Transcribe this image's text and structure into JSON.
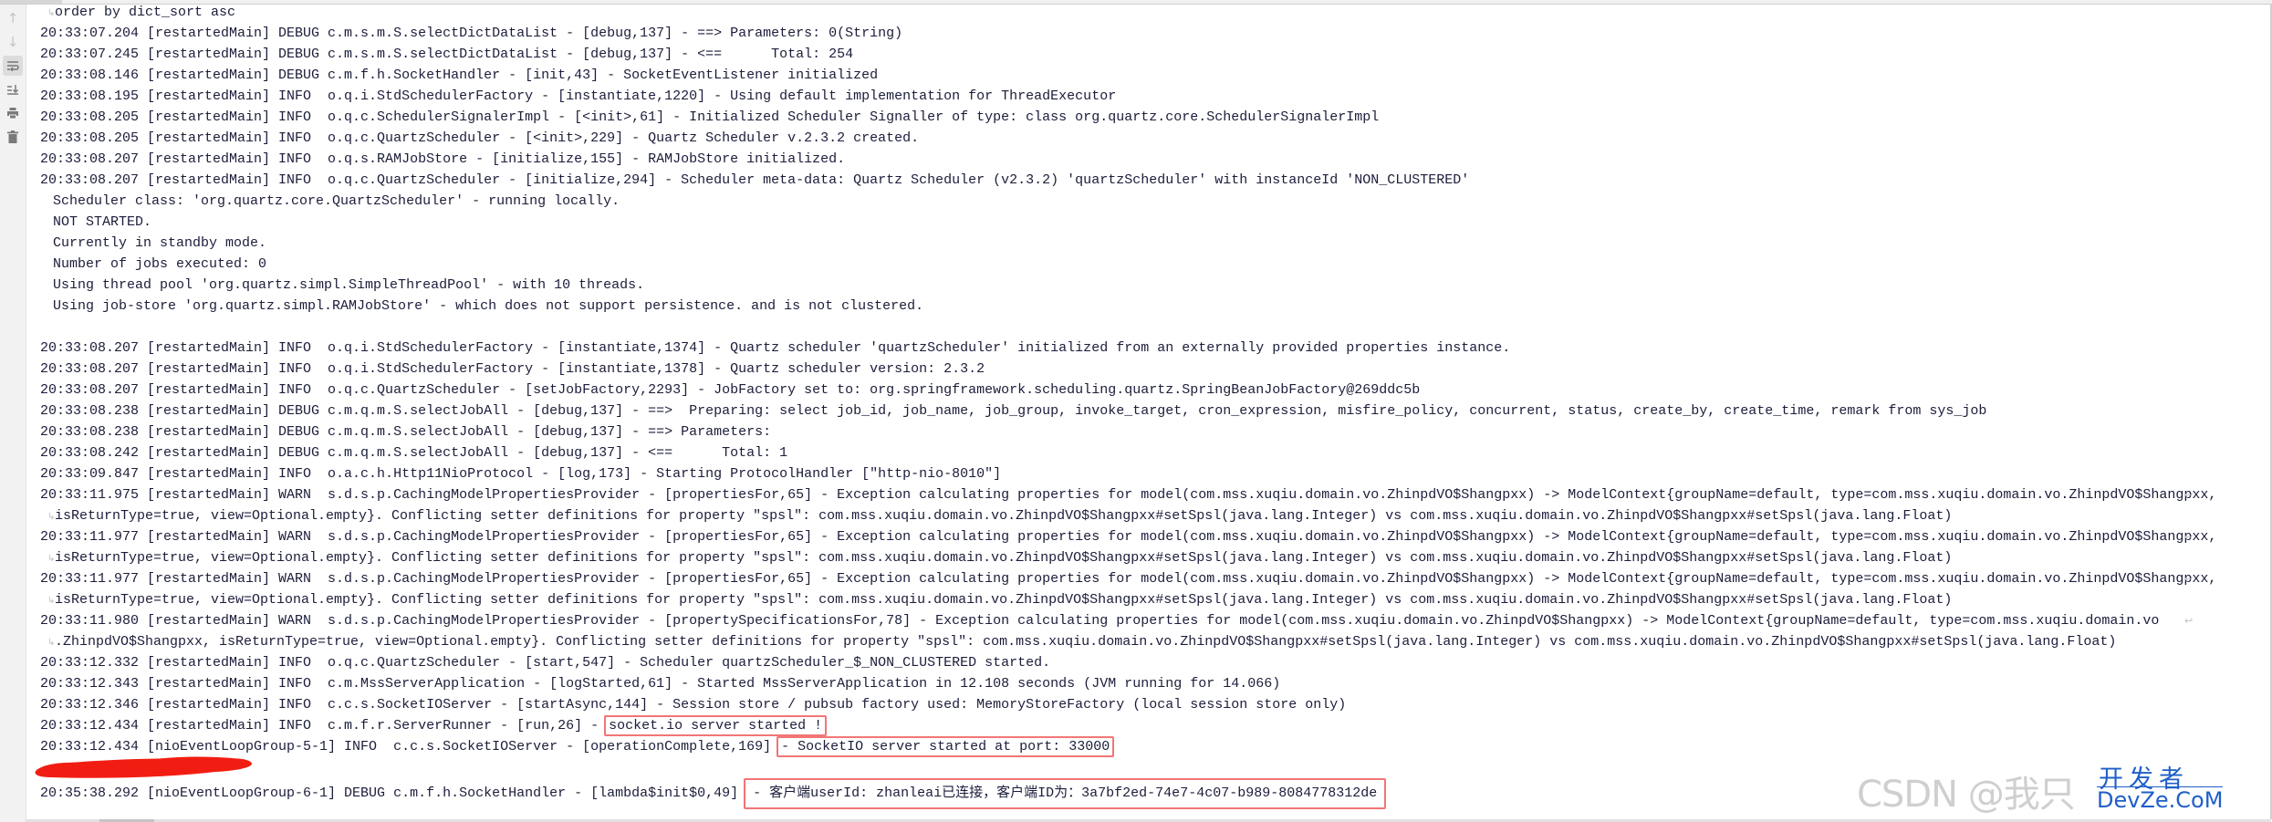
{
  "toolbar": {
    "icons": [
      "arrow-up-icon",
      "arrow-down-icon",
      "soft-wrap-icon",
      "scroll-to-end-icon",
      "print-icon",
      "trash-icon"
    ]
  },
  "colors": {
    "highlight_border": "#f27575",
    "text": "#1b1d3a",
    "watermark_blue": "#1f5fc8"
  },
  "console": {
    "lines": [
      {
        "kind": "wrapcont",
        "text": "order by dict_sort asc"
      },
      {
        "text": "20:33:07.204 [restartedMain] DEBUG c.m.s.m.S.selectDictDataList - [debug,137] - ==> Parameters: 0(String)"
      },
      {
        "text": "20:33:07.245 [restartedMain] DEBUG c.m.s.m.S.selectDictDataList - [debug,137] - <==      Total: 254"
      },
      {
        "text": "20:33:08.146 [restartedMain] DEBUG c.m.f.h.SocketHandler - [init,43] - SocketEventListener initialized"
      },
      {
        "text": "20:33:08.195 [restartedMain] INFO  o.q.i.StdSchedulerFactory - [instantiate,1220] - Using default implementation for ThreadExecutor"
      },
      {
        "text": "20:33:08.205 [restartedMain] INFO  o.q.c.SchedulerSignalerImpl - [<init>,61] - Initialized Scheduler Signaller of type: class org.quartz.core.SchedulerSignalerImpl"
      },
      {
        "text": "20:33:08.205 [restartedMain] INFO  o.q.c.QuartzScheduler - [<init>,229] - Quartz Scheduler v.2.3.2 created."
      },
      {
        "text": "20:33:08.207 [restartedMain] INFO  o.q.s.RAMJobStore - [initialize,155] - RAMJobStore initialized."
      },
      {
        "text": "20:33:08.207 [restartedMain] INFO  o.q.c.QuartzScheduler - [initialize,294] - Scheduler meta-data: Quartz Scheduler (v2.3.2) 'quartzScheduler' with instanceId 'NON_CLUSTERED'"
      },
      {
        "kind": "indent",
        "text": "Scheduler class: 'org.quartz.core.QuartzScheduler' - running locally."
      },
      {
        "kind": "indent",
        "text": "NOT STARTED."
      },
      {
        "kind": "indent",
        "text": "Currently in standby mode."
      },
      {
        "kind": "indent",
        "text": "Number of jobs executed: 0"
      },
      {
        "kind": "indent",
        "text": "Using thread pool 'org.quartz.simpl.SimpleThreadPool' - with 10 threads."
      },
      {
        "kind": "indent",
        "text": "Using job-store 'org.quartz.simpl.RAMJobStore' - which does not support persistence. and is not clustered."
      },
      {
        "text": ""
      },
      {
        "text": "20:33:08.207 [restartedMain] INFO  o.q.i.StdSchedulerFactory - [instantiate,1374] - Quartz scheduler 'quartzScheduler' initialized from an externally provided properties instance."
      },
      {
        "text": "20:33:08.207 [restartedMain] INFO  o.q.i.StdSchedulerFactory - [instantiate,1378] - Quartz scheduler version: 2.3.2"
      },
      {
        "text": "20:33:08.207 [restartedMain] INFO  o.q.c.QuartzScheduler - [setJobFactory,2293] - JobFactory set to: org.springframework.scheduling.quartz.SpringBeanJobFactory@269ddc5b"
      },
      {
        "text": "20:33:08.238 [restartedMain] DEBUG c.m.q.m.S.selectJobAll - [debug,137] - ==>  Preparing: select job_id, job_name, job_group, invoke_target, cron_expression, misfire_policy, concurrent, status, create_by, create_time, remark from sys_job"
      },
      {
        "text": "20:33:08.238 [restartedMain] DEBUG c.m.q.m.S.selectJobAll - [debug,137] - ==> Parameters: "
      },
      {
        "text": "20:33:08.242 [restartedMain] DEBUG c.m.q.m.S.selectJobAll - [debug,137] - <==      Total: 1"
      },
      {
        "text": "20:33:09.847 [restartedMain] INFO  o.a.c.h.Http11NioProtocol - [log,173] - Starting ProtocolHandler [\"http-nio-8010\"]"
      },
      {
        "kind": "wrapped",
        "text": "20:33:11.975 [restartedMain] WARN  s.d.s.p.CachingModelPropertiesProvider - [propertiesFor,65] - Exception calculating properties for model(com.mss.xuqiu.domain.vo.ZhinpdVO$Shangpxx) -> ModelContext{groupName=default, type=com.mss.xuqiu.domain.vo.ZhinpdVO$Shangpxx,"
      },
      {
        "kind": "wrapcont",
        "text": "isReturnType=true, view=Optional.empty}. Conflicting setter definitions for property \"spsl\": com.mss.xuqiu.domain.vo.ZhinpdVO$Shangpxx#setSpsl(java.lang.Integer) vs com.mss.xuqiu.domain.vo.ZhinpdVO$Shangpxx#setSpsl(java.lang.Float)"
      },
      {
        "kind": "wrapped",
        "text": "20:33:11.977 [restartedMain] WARN  s.d.s.p.CachingModelPropertiesProvider - [propertiesFor,65] - Exception calculating properties for model(com.mss.xuqiu.domain.vo.ZhinpdVO$Shangpxx) -> ModelContext{groupName=default, type=com.mss.xuqiu.domain.vo.ZhinpdVO$Shangpxx,"
      },
      {
        "kind": "wrapcont",
        "text": "isReturnType=true, view=Optional.empty}. Conflicting setter definitions for property \"spsl\": com.mss.xuqiu.domain.vo.ZhinpdVO$Shangpxx#setSpsl(java.lang.Integer) vs com.mss.xuqiu.domain.vo.ZhinpdVO$Shangpxx#setSpsl(java.lang.Float)"
      },
      {
        "kind": "wrapped",
        "text": "20:33:11.977 [restartedMain] WARN  s.d.s.p.CachingModelPropertiesProvider - [propertiesFor,65] - Exception calculating properties for model(com.mss.xuqiu.domain.vo.ZhinpdVO$Shangpxx) -> ModelContext{groupName=default, type=com.mss.xuqiu.domain.vo.ZhinpdVO$Shangpxx,"
      },
      {
        "kind": "wrapcont",
        "text": "isReturnType=true, view=Optional.empty}. Conflicting setter definitions for property \"spsl\": com.mss.xuqiu.domain.vo.ZhinpdVO$Shangpxx#setSpsl(java.lang.Integer) vs com.mss.xuqiu.domain.vo.ZhinpdVO$Shangpxx#setSpsl(java.lang.Float)"
      },
      {
        "kind": "wrapped",
        "text": "20:33:11.980 [restartedMain] WARN  s.d.s.p.CachingModelPropertiesProvider - [propertySpecificationsFor,78] - Exception calculating properties for model(com.mss.xuqiu.domain.vo.ZhinpdVO$Shangpxx) -> ModelContext{groupName=default, type=com.mss.xuqiu.domain.vo"
      },
      {
        "kind": "wrapcont",
        "text": ".ZhinpdVO$Shangpxx, isReturnType=true, view=Optional.empty}. Conflicting setter definitions for property \"spsl\": com.mss.xuqiu.domain.vo.ZhinpdVO$Shangpxx#setSpsl(java.lang.Integer) vs com.mss.xuqiu.domain.vo.ZhinpdVO$Shangpxx#setSpsl(java.lang.Float)"
      },
      {
        "text": "20:33:12.332 [restartedMain] INFO  o.q.c.QuartzScheduler - [start,547] - Scheduler quartzScheduler_$_NON_CLUSTERED started."
      },
      {
        "text": "20:33:12.343 [restartedMain] INFO  c.m.MssServerApplication - [logStarted,61] - Started MssServerApplication in 12.108 seconds (JVM running for 14.066)"
      },
      {
        "text": "20:33:12.346 [restartedMain] INFO  c.c.s.SocketIOServer - [startAsync,144] - Session store / pubsub factory used: MemoryStoreFactory (local session store only)"
      },
      {
        "text": "20:33:12.434 [restartedMain] INFO  c.m.f.r.ServerRunner - [run,26] - ",
        "highlight": "socket.io server started !"
      },
      {
        "text": "20:33:12.434 [nioEventLoopGroup-5-1] INFO  c.c.s.SocketIOServer - [operationComplete,169] ",
        "highlight": "- SocketIO server started at port: 33000"
      },
      {
        "text": "",
        "redacted": true
      },
      {
        "text": "20:35:38.292 [nioEventLoopGroup-6-1] DEBUG c.m.f.h.SocketHandler - [lambda$init$0,49] ",
        "highlight": "- 客户端userId: zhanleai已连接，客户端ID为：3a7bf2ed-74e7-4c07-b989-8084778312de",
        "tall": true
      }
    ]
  },
  "watermark": {
    "gray": "CSDN @我只",
    "blue_top": "开发者",
    "blue_bottom": "DevZe.CoM"
  }
}
